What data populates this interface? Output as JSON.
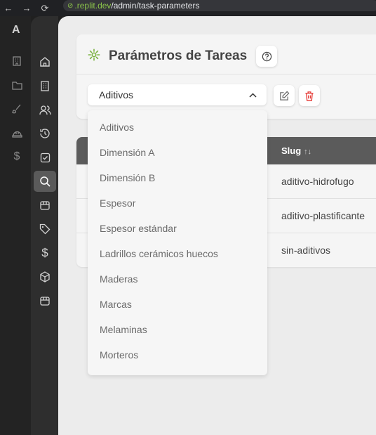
{
  "browser": {
    "back_icon": "←",
    "forward_icon": "→",
    "reload_icon": "⟳",
    "url_domain": ".replit.dev",
    "url_path": "/admin/task-parameters"
  },
  "rail": {
    "logo": "A"
  },
  "page": {
    "title": "Parámetros de Tareas"
  },
  "select": {
    "value": "Aditivos"
  },
  "dropdown": {
    "options": [
      "Aditivos",
      "Dimensión A",
      "Dimensión B",
      "Espesor",
      "Espesor estándar",
      "Ladrillos cerámicos huecos",
      "Maderas",
      "Marcas",
      "Melaminas",
      "Morteros"
    ]
  },
  "table": {
    "column_slug": "Slug",
    "sort_icon": "↑↓",
    "rows": [
      {
        "slug": "aditivo-hidrofugo"
      },
      {
        "slug": "aditivo-plastificante"
      },
      {
        "slug": "sin-aditivos"
      }
    ]
  },
  "colors": {
    "accent_green": "#7cb342",
    "delete_red": "#e53935",
    "header_gray": "#5b5b5b"
  }
}
